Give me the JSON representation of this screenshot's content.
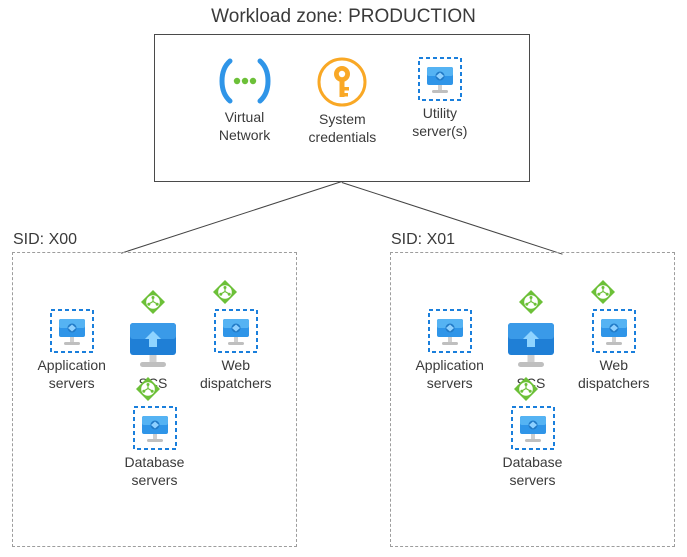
{
  "zone": {
    "title": "Workload zone: PRODUCTION",
    "vnet": "Virtual\nNetwork",
    "creds": "System\ncredentials",
    "utility": "Utility\nserver(s)"
  },
  "sids": [
    {
      "title": "SID: X00",
      "app": "Application\nservers",
      "scs": "SCS",
      "web": "Web\ndispatchers",
      "db": "Database\nservers"
    },
    {
      "title": "SID: X01",
      "app": "Application\nservers",
      "scs": "SCS",
      "web": "Web\ndispatchers",
      "db": "Database\nservers"
    }
  ]
}
